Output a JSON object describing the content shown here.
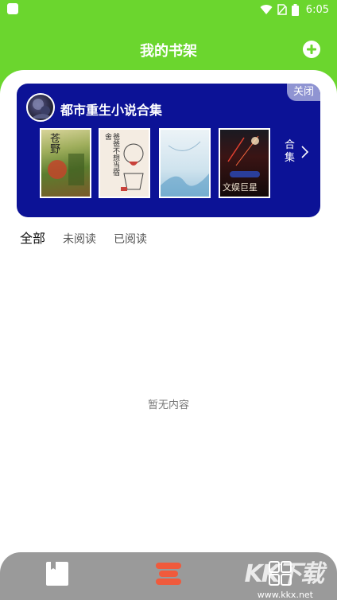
{
  "status_bar": {
    "time": "6:05"
  },
  "header": {
    "title": "我的书架"
  },
  "collection": {
    "title": "都市重生小说合集",
    "close_label": "关闭",
    "more_label": "合集",
    "books": [
      {
        "cover_title": "苍野"
      },
      {
        "cover_title": "爸爸不想当宿舍"
      },
      {
        "cover_title": ""
      },
      {
        "cover_title": "文娱巨星"
      }
    ]
  },
  "tabs": [
    {
      "label": "全部",
      "active": true
    },
    {
      "label": "未阅读",
      "active": false
    },
    {
      "label": "已阅读",
      "active": false
    }
  ],
  "empty_state": {
    "text": "暂无内容"
  },
  "bottom_nav": [
    {
      "icon": "book-icon"
    },
    {
      "icon": "bookshelf-icon"
    },
    {
      "icon": "grid-icon"
    }
  ],
  "watermark": {
    "url": "www.kkx.net"
  },
  "colors": {
    "brand_green": "#6bd62e",
    "card_blue": "#0c1296",
    "nav_accent": "#f05a3c",
    "nav_bg": "#9a9a9a"
  }
}
